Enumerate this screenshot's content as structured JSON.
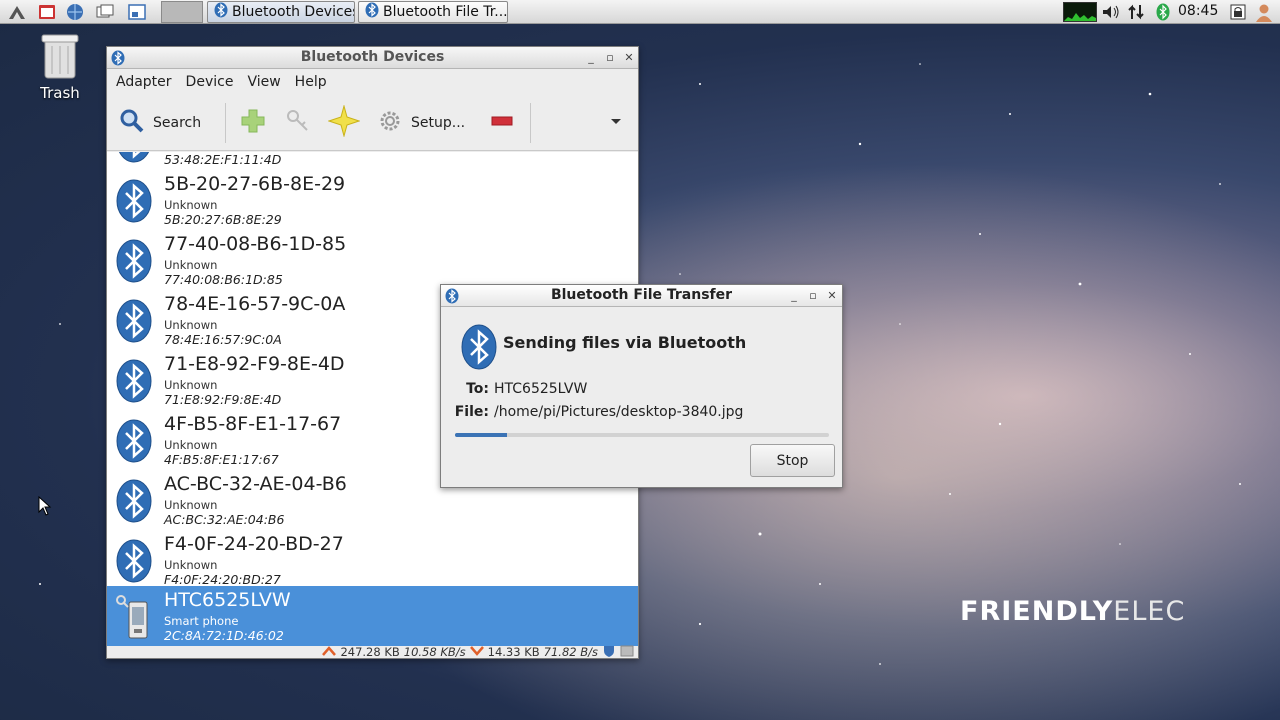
{
  "colors": {
    "selection": "#4a90d9",
    "progress": "#3b73b5",
    "bluetooth": "#2f6db5"
  },
  "taskbar": {
    "tasks": [
      {
        "label": "Bluetooth Devices",
        "icon": "bluetooth-icon"
      },
      {
        "label": "Bluetooth File Tr...",
        "icon": "bluetooth-icon"
      }
    ],
    "clock": "08:45"
  },
  "desktop": {
    "trash_label": "Trash",
    "brand_bold": "FRIENDLY",
    "brand_light": "ELEC"
  },
  "devices_window": {
    "title": "Bluetooth Devices",
    "menu": [
      "Adapter",
      "Device",
      "View",
      "Help"
    ],
    "toolbar": {
      "search_label": "Search",
      "setup_label": "Setup..."
    },
    "partial_addr": "53:48:2E:F1:11:4D",
    "devices": [
      {
        "name": "5B-20-27-6B-8E-29",
        "class": "Unknown",
        "addr": "5B:20:27:6B:8E:29"
      },
      {
        "name": "77-40-08-B6-1D-85",
        "class": "Unknown",
        "addr": "77:40:08:B6:1D:85"
      },
      {
        "name": "78-4E-16-57-9C-0A",
        "class": "Unknown",
        "addr": "78:4E:16:57:9C:0A"
      },
      {
        "name": "71-E8-92-F9-8E-4D",
        "class": "Unknown",
        "addr": "71:E8:92:F9:8E:4D"
      },
      {
        "name": "4F-B5-8F-E1-17-67",
        "class": "Unknown",
        "addr": "4F:B5:8F:E1:17:67"
      },
      {
        "name": "AC-BC-32-AE-04-B6",
        "class": "Unknown",
        "addr": "AC:BC:32:AE:04:B6"
      },
      {
        "name": "F4-0F-24-20-BD-27",
        "class": "Unknown",
        "addr": "F4:0F:24:20:BD:27"
      },
      {
        "name": "HTC6525LVW",
        "class": "Smart phone",
        "addr": "2C:8A:72:1D:46:02"
      }
    ],
    "status": {
      "up_total": "247.28 KB",
      "up_rate": "10.58 KB/s",
      "down_total": "14.33 KB",
      "down_rate": "71.82 B/s"
    }
  },
  "transfer_window": {
    "title": "Bluetooth File Transfer",
    "heading": "Sending files via Bluetooth",
    "to_label": "To:",
    "to_value": "HTC6525LVW",
    "file_label": "File:",
    "file_value": "/home/pi/Pictures/desktop-3840.jpg",
    "progress": 0.14,
    "stop_label": "Stop"
  }
}
